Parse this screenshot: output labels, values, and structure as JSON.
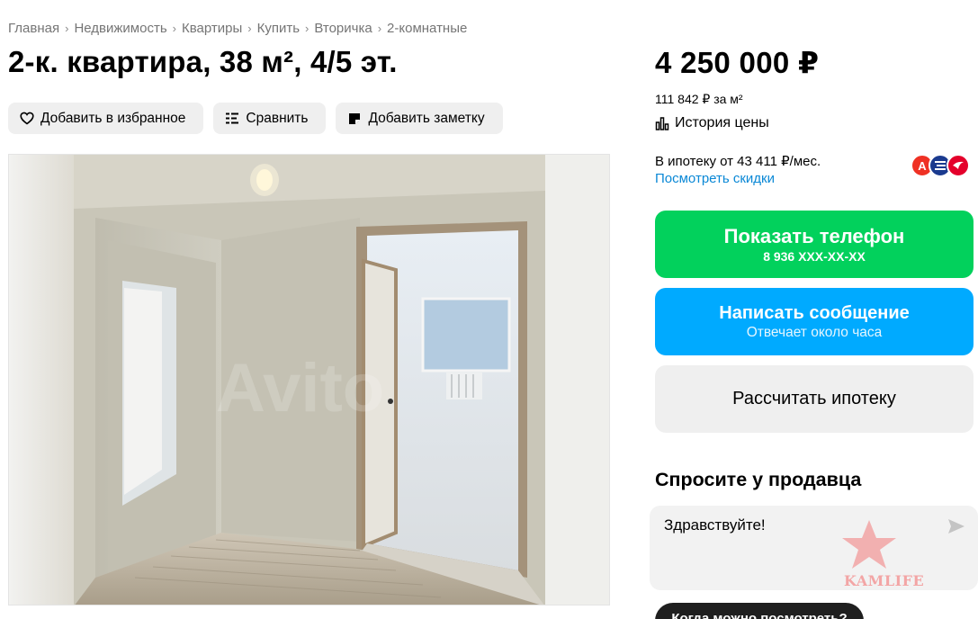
{
  "breadcrumbs": [
    "Главная",
    "Недвижимость",
    "Квартиры",
    "Купить",
    "Вторичка",
    "2-комнатные"
  ],
  "title": "2-к. квартира, 38 м², 4/5 эт.",
  "actions": {
    "favorite": "Добавить в избранное",
    "compare": "Сравнить",
    "note": "Добавить заметку"
  },
  "price": {
    "total": "4 250 000 ₽",
    "per_meter": "111 842 ₽ за м²",
    "history": "История цены"
  },
  "mortgage": {
    "text": "В ипотеку от 43 411 ₽/мес.",
    "discounts_link": "Посмотреть скидки",
    "bank_icons": [
      "alfa-bank-icon",
      "bank-icon-blue",
      "sovcombank-icon"
    ]
  },
  "buttons": {
    "phone_label": "Показать телефон",
    "phone_number": "8 936 XXX-XX-XX",
    "message_label": "Написать сообщение",
    "message_sub": "Отвечает около часа",
    "mortgage_calc": "Рассчитать ипотеку"
  },
  "ask": {
    "title": "Спросите у продавца",
    "message": "Здравствуйте!",
    "chip": "Когда можно посмотреть?"
  },
  "watermark": {
    "text": "KAMLIFE"
  },
  "colors": {
    "green": "#02d15c",
    "blue": "#00aaff",
    "link": "#0a88d6"
  }
}
